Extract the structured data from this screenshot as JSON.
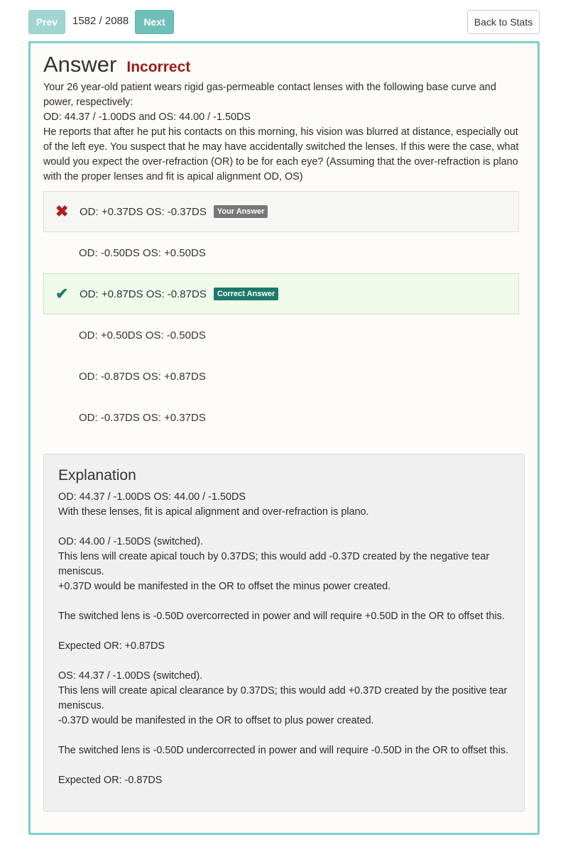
{
  "nav": {
    "prev_label": "Prev",
    "next_label": "Next",
    "counter": "1582 / 2088",
    "back_label": "Back to Stats"
  },
  "answer": {
    "title": "Answer",
    "result": "Incorrect",
    "result_color": "#9b1c1c",
    "question_lines": [
      "Your 26 year-old patient wears rigid gas-permeable contact lenses with the following base curve and power, respectively:",
      "OD: 44.37 / -1.00DS and OS: 44.00 / -1.50DS",
      "He reports that after he put his contacts on this morning, his vision was blurred at distance, especially out of the left eye. You suspect that he may have accidentally switched the lenses. If this were the case, what would you expect the over-refraction (OR) to be for each eye? (Assuming that the over-refraction is plano with the proper lenses and fit is apical alignment OD, OS)"
    ],
    "options": [
      {
        "text": "OD: +0.37DS OS: -0.37DS",
        "state": "selected",
        "icon": "x-icon",
        "badge": "Your Answer"
      },
      {
        "text": "OD: -0.50DS OS: +0.50DS",
        "state": "none"
      },
      {
        "text": "OD: +0.87DS OS: -0.87DS",
        "state": "correct",
        "icon": "check-icon",
        "badge": "Correct Answer"
      },
      {
        "text": "OD: +0.50DS OS: -0.50DS",
        "state": "none"
      },
      {
        "text": "OD: -0.87DS OS: +0.87DS",
        "state": "none"
      },
      {
        "text": "OD: -0.37DS OS: +0.37DS",
        "state": "none"
      }
    ]
  },
  "explanation": {
    "title": "Explanation",
    "lines": [
      "OD: 44.37 / -1.00DS OS: 44.00 / -1.50DS",
      "With these lenses, fit is apical alignment and over-refraction is plano.",
      "",
      "OD: 44.00 / -1.50DS (switched).",
      "This lens will create apical touch by 0.37DS; this would add -0.37D created by the negative tear meniscus.",
      "+0.37D would be manifested in the OR to offset the minus power created.",
      "",
      "The switched lens is -0.50D overcorrected in power and will require +0.50D in the OR to offset this.",
      "",
      "Expected OR: +0.87DS",
      "",
      "OS: 44.37 / -1.00DS (switched).",
      "This lens will create apical clearance by 0.37DS; this would add +0.37D created by the positive tear meniscus.",
      "-0.37D would be manifested in the OR to offset to plus power created.",
      "",
      "The switched lens is -0.50D undercorrected in power and will require -0.50D in the OR to offset this.",
      "",
      "Expected OR: -0.87DS"
    ]
  }
}
